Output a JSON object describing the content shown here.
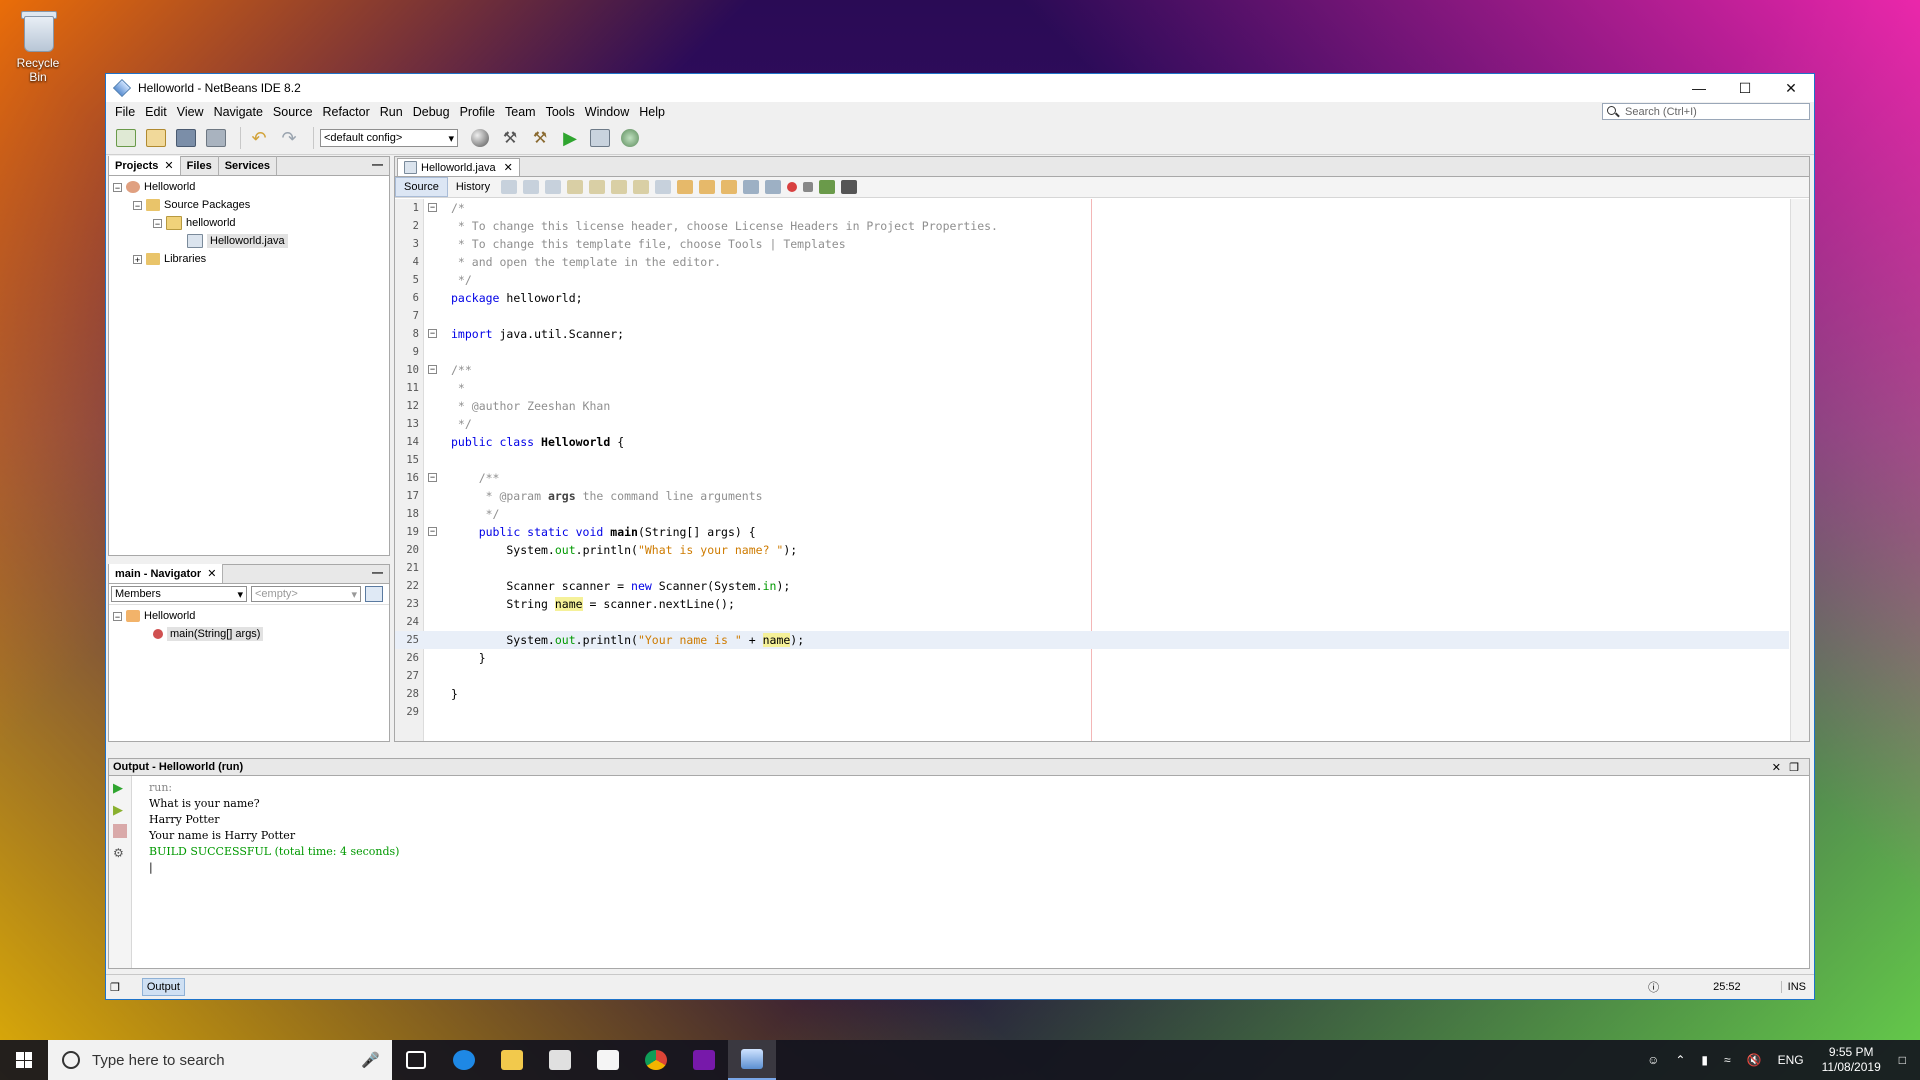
{
  "desktop": {
    "recycle_bin": "Recycle Bin"
  },
  "window": {
    "title": "Helloworld - NetBeans IDE 8.2"
  },
  "menu": [
    "File",
    "Edit",
    "View",
    "Navigate",
    "Source",
    "Refactor",
    "Run",
    "Debug",
    "Profile",
    "Team",
    "Tools",
    "Window",
    "Help"
  ],
  "search": {
    "placeholder": "Search (Ctrl+I)"
  },
  "toolbar": {
    "config": "<default config>"
  },
  "projects": {
    "tabs": [
      "Projects",
      "Files",
      "Services"
    ],
    "tree": {
      "root": "Helloworld",
      "source_packages": "Source Packages",
      "package": "helloworld",
      "file": "Helloworld.java",
      "libraries": "Libraries"
    }
  },
  "navigator": {
    "title": "main - Navigator",
    "filter": "Members",
    "empty": "<empty>",
    "class": "Helloworld",
    "method": "main(String[] args)"
  },
  "editor": {
    "tab": "Helloworld.java",
    "source_btn": "Source",
    "history_btn": "History"
  },
  "code": [
    "/*",
    " * To change this license header, choose License Headers in Project Properties.",
    " * To change this template file, choose Tools | Templates",
    " * and open the template in the editor.",
    " */",
    "package helloworld;",
    "",
    "import java.util.Scanner;",
    "",
    "/**",
    " *",
    " * @author Zeeshan Khan",
    " */",
    "public class Helloworld {",
    "",
    "    /**",
    "     * @param args the command line arguments",
    "     */",
    "    public static void main(String[] args) {",
    "        System.out.println(\"What is your name? \");",
    "",
    "        Scanner scanner = new Scanner(System.in);",
    "        String name = scanner.nextLine();",
    "",
    "        System.out.println(\"Your name is \" + name);",
    "    }",
    "",
    "}",
    ""
  ],
  "output": {
    "title": "Output - Helloworld (run)",
    "lines": [
      "run:",
      "What is your name?",
      "Harry Potter",
      "Your name is Harry Potter",
      "BUILD SUCCESSFUL (total time: 4 seconds)"
    ]
  },
  "status": {
    "output_tab": "Output",
    "position": "25:52",
    "mode": "INS"
  },
  "taskbar": {
    "search_placeholder": "Type here to search",
    "lang": "ENG",
    "time": "9:55 PM",
    "date": "11/08/2019"
  }
}
